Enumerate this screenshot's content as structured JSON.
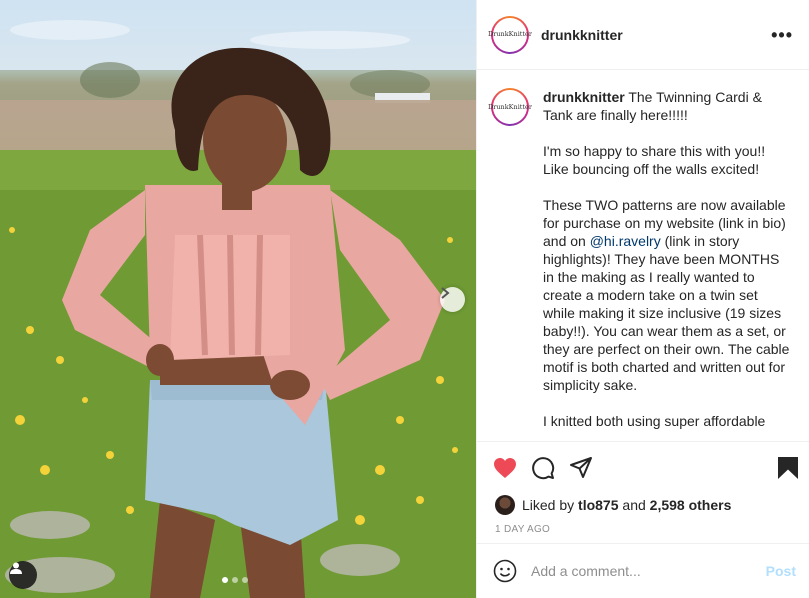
{
  "post": {
    "username": "drunkknitter",
    "avatar_text": [
      "Drunk",
      "Knitter"
    ],
    "caption_paragraphs": [
      "I'm so happy to share this with you!! Like bouncing off the walls excited!",
      "I knitted both using super affordable"
    ],
    "caption_first_line": "The Twinning Cardi & Tank are finally here!!!!!",
    "caption_para2_before": "These TWO patterns are now available for purchase on my website (link in bio) and on ",
    "caption_mention": "@hi.ravelry",
    "caption_para2_after": " (link in story highlights)! They have been MONTHS in the making as I really wanted to create a modern take on a twin set while making it size inclusive (19 sizes baby!!). You can wear them as a set, or they are perfect on their own. The cable motif is both charted and written out for simplicity sake."
  },
  "likes": {
    "prefix": "Liked by ",
    "user": "tlo875",
    "middle": " and ",
    "count": "2,598 others"
  },
  "timestamp": "1 DAY AGO",
  "comment": {
    "placeholder": "Add a comment...",
    "post_label": "Post"
  },
  "carousel": {
    "total": 3,
    "active": 0
  },
  "icons": [
    "heart-icon",
    "comment-icon",
    "share-icon",
    "bookmark-icon",
    "emoji-icon",
    "more-icon",
    "chevron-right-icon",
    "user-tag-icon"
  ],
  "colors": {
    "like_red": "#ed4956",
    "link": "#00376b",
    "post_button": "#b2dffc",
    "muted": "#8e8e8e"
  }
}
